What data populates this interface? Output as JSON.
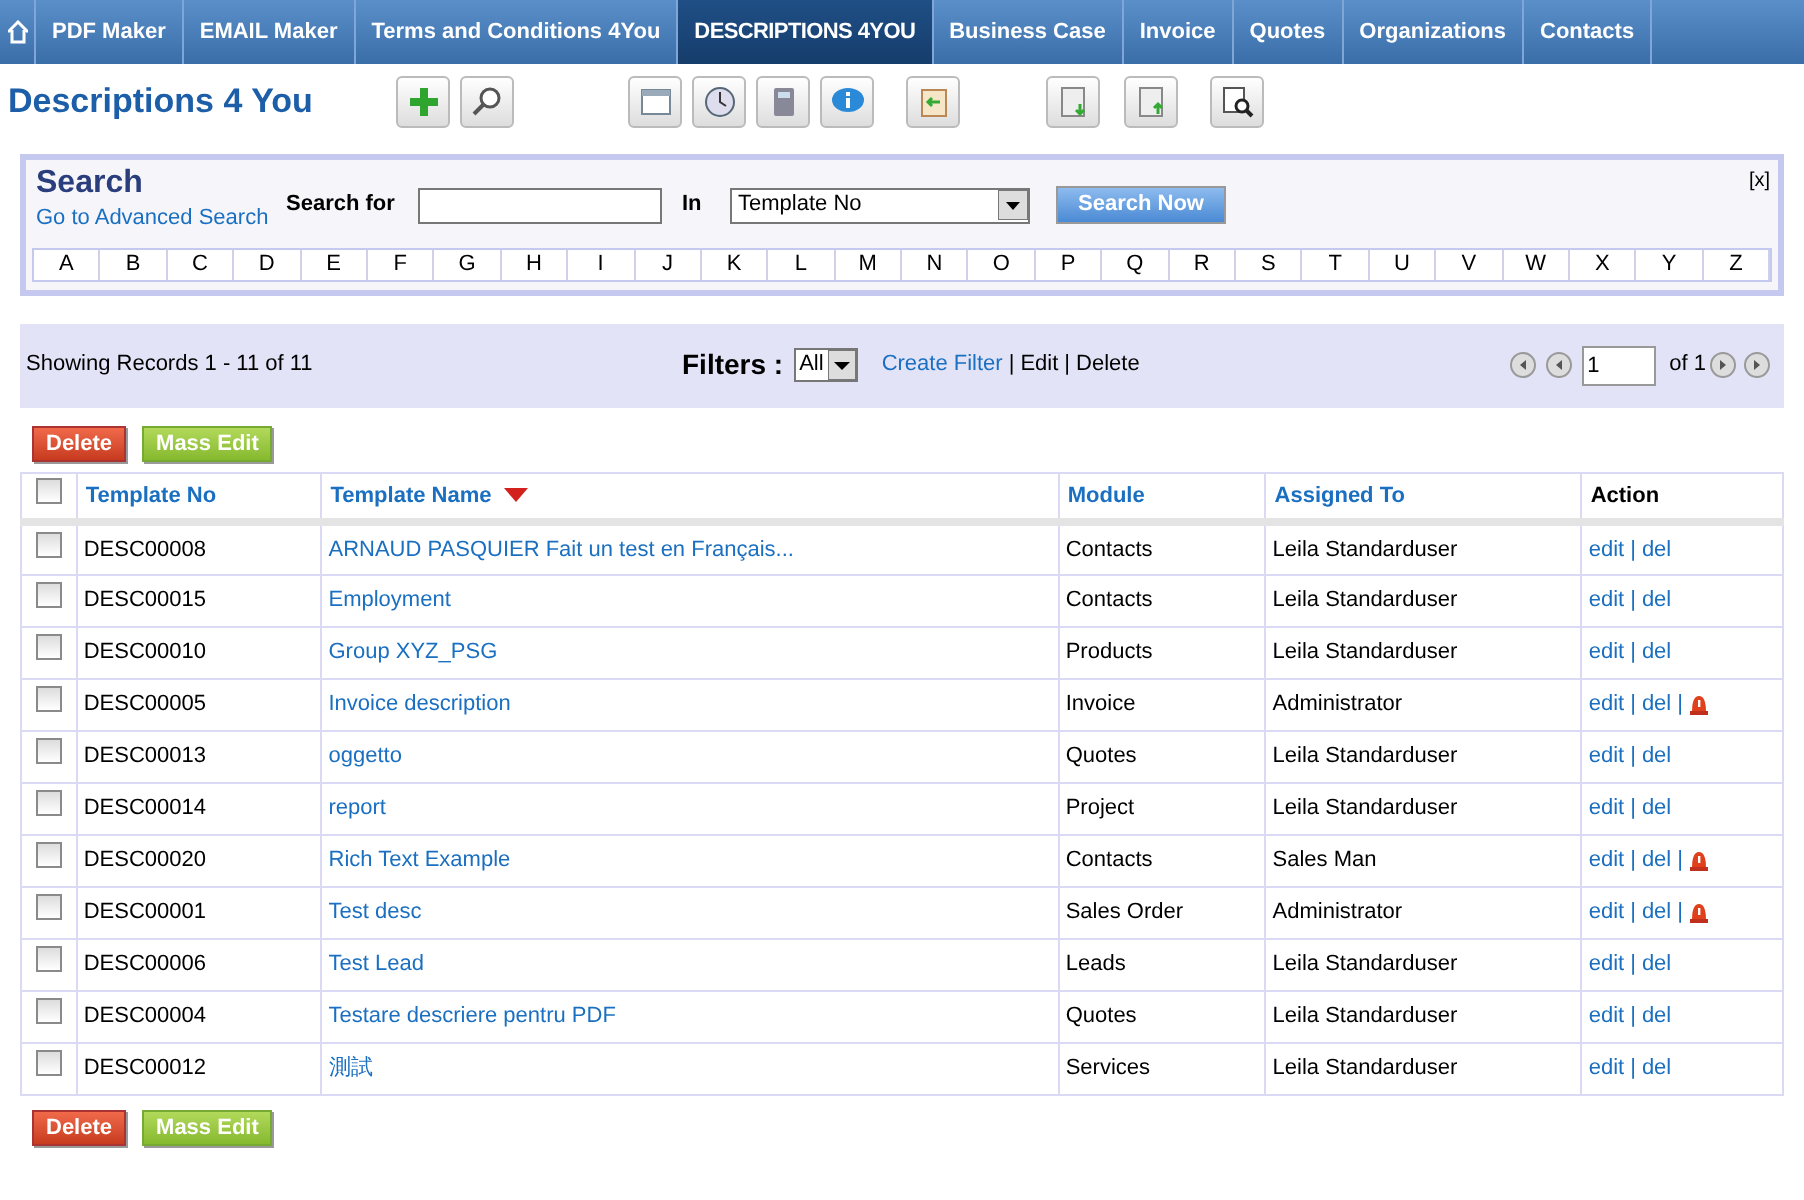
{
  "nav": {
    "tabs": [
      {
        "label": "PDF Maker",
        "selected": false
      },
      {
        "label": "EMAIL Maker",
        "selected": false
      },
      {
        "label": "Terms and Conditions 4You",
        "selected": false
      },
      {
        "label": "DESCRIPTIONS 4YOU",
        "selected": true
      },
      {
        "label": "Business Case",
        "selected": false
      },
      {
        "label": "Invoice",
        "selected": false
      },
      {
        "label": "Quotes",
        "selected": false
      },
      {
        "label": "Organizations",
        "selected": false
      },
      {
        "label": "Contacts",
        "selected": false
      }
    ]
  },
  "page_title": "Descriptions 4 You",
  "search": {
    "title": "Search",
    "advanced_link": "Go to Advanced Search",
    "search_for_label": "Search for",
    "in_label": "In",
    "in_value": "Template No",
    "button": "Search Now",
    "close": "[x]",
    "letters": [
      "A",
      "B",
      "C",
      "D",
      "E",
      "F",
      "G",
      "H",
      "I",
      "J",
      "K",
      "L",
      "M",
      "N",
      "O",
      "P",
      "Q",
      "R",
      "S",
      "T",
      "U",
      "V",
      "W",
      "X",
      "Y",
      "Z"
    ]
  },
  "list_bar": {
    "showing": "Showing Records 1 - 11 of 11",
    "filters_label": "Filters :",
    "filter_value": "All",
    "create_filter": "Create Filter",
    "edit": "Edit",
    "delete": "Delete",
    "separator": "|",
    "page": "1",
    "of_pages": "of 1"
  },
  "top_buttons": {
    "delete": "Delete",
    "mass_edit": "Mass Edit"
  },
  "bottom_buttons": {
    "delete": "Delete",
    "mass_edit": "Mass Edit"
  },
  "table": {
    "select_all_checked": false,
    "columns": [
      {
        "label": "Template No",
        "link": true,
        "sorted": false
      },
      {
        "label": "Template Name",
        "link": true,
        "sorted": true
      },
      {
        "label": "Module",
        "link": true,
        "sorted": false
      },
      {
        "label": "Assigned To",
        "link": true,
        "sorted": false
      },
      {
        "label": "Action",
        "link": false,
        "sorted": false
      }
    ],
    "rows": [
      {
        "checked": false,
        "no": "DESC00008",
        "name": "ARNAUD PASQUIER Fait un test en Français...",
        "module": "Contacts",
        "assigned": "Leila Standarduser",
        "edit": "edit",
        "del": "del",
        "warning": false
      },
      {
        "checked": false,
        "no": "DESC00015",
        "name": "Employment",
        "module": "Contacts",
        "assigned": "Leila Standarduser",
        "edit": "edit",
        "del": "del",
        "warning": false
      },
      {
        "checked": false,
        "no": "DESC00010",
        "name": "Group XYZ_PSG",
        "module": "Products",
        "assigned": "Leila Standarduser",
        "edit": "edit",
        "del": "del",
        "warning": false
      },
      {
        "checked": false,
        "no": "DESC00005",
        "name": "Invoice description",
        "module": "Invoice",
        "assigned": "Administrator",
        "edit": "edit",
        "del": "del",
        "warning": true
      },
      {
        "checked": false,
        "no": "DESC00013",
        "name": "oggetto",
        "module": "Quotes",
        "assigned": "Leila Standarduser",
        "edit": "edit",
        "del": "del",
        "warning": false
      },
      {
        "checked": false,
        "no": "DESC00014",
        "name": "report",
        "module": "Project",
        "assigned": "Leila Standarduser",
        "edit": "edit",
        "del": "del",
        "warning": false
      },
      {
        "checked": false,
        "no": "DESC00020",
        "name": "Rich Text Example",
        "module": "Contacts",
        "assigned": "Sales Man",
        "edit": "edit",
        "del": "del",
        "warning": true
      },
      {
        "checked": false,
        "no": "DESC00001",
        "name": "Test desc",
        "module": "Sales Order",
        "assigned": "Administrator",
        "edit": "edit",
        "del": "del",
        "warning": true
      },
      {
        "checked": false,
        "no": "DESC00006",
        "name": "Test Lead",
        "module": "Leads",
        "assigned": "Leila Standarduser",
        "edit": "edit",
        "del": "del",
        "warning": false
      },
      {
        "checked": false,
        "no": "DESC00004",
        "name": "Testare descriere pentru PDF",
        "module": "Quotes",
        "assigned": "Leila Standarduser",
        "edit": "edit",
        "del": "del",
        "warning": false
      },
      {
        "checked": false,
        "no": "DESC00012",
        "name": "測試",
        "module": "Services",
        "assigned": "Leila Standarduser",
        "edit": "edit",
        "del": "del",
        "warning": false
      }
    ]
  }
}
